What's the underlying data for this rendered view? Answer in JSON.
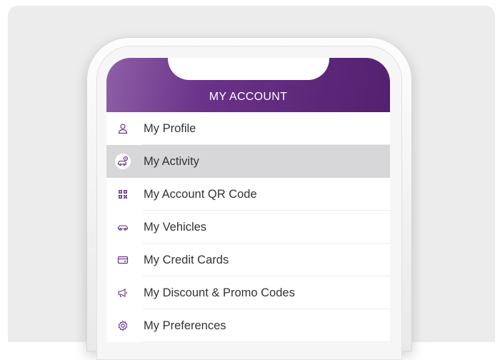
{
  "header": {
    "title": "MY ACCOUNT"
  },
  "menu": [
    {
      "label": "My Profile",
      "icon": "person-icon",
      "active": false
    },
    {
      "label": "My Activity",
      "icon": "car-clock-icon",
      "active": true
    },
    {
      "label": "My Account QR Code",
      "icon": "qr-code-icon",
      "active": false
    },
    {
      "label": "My Vehicles",
      "icon": "car-icon",
      "active": false
    },
    {
      "label": "My Credit Cards",
      "icon": "credit-card-icon",
      "active": false
    },
    {
      "label": "My Discount & Promo Codes",
      "icon": "megaphone-icon",
      "active": false
    },
    {
      "label": "My Preferences",
      "icon": "gear-icon",
      "active": false
    }
  ],
  "colors": {
    "accent": "#5b2479",
    "icon": "#6a3289",
    "active_row": "#d7d7d9"
  }
}
